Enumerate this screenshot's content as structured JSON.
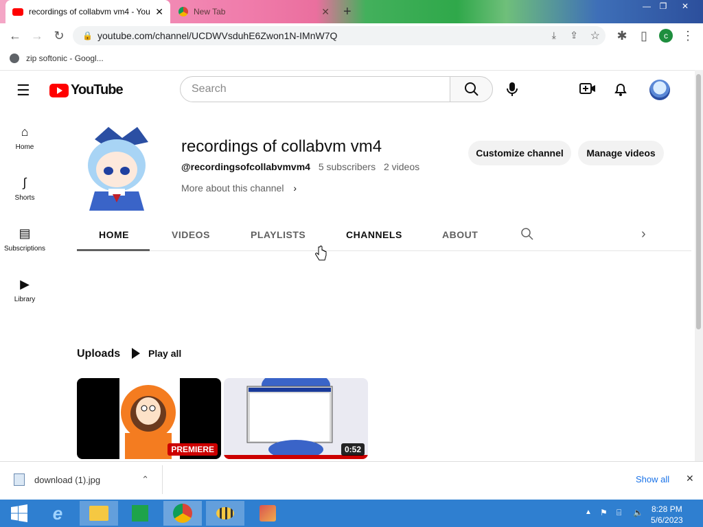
{
  "browser": {
    "tabs": [
      {
        "title": "recordings of collabvm vm4 - You",
        "active": true
      },
      {
        "title": "New Tab",
        "active": false
      }
    ],
    "new_tab": "+",
    "window_buttons": {
      "minimize": "—",
      "restore": "❐",
      "close": "✕"
    },
    "url": "youtube.com/channel/UCDWVsduhE6Zwon1N-IMnW7Q",
    "profile_initial": "c",
    "bookmarks": [
      {
        "label": "zip softonic - Googl..."
      }
    ]
  },
  "youtube": {
    "logo_text": "YouTube",
    "search_placeholder": "Search",
    "sidebar": [
      {
        "label": "Home",
        "icon": "home-icon"
      },
      {
        "label": "Shorts",
        "icon": "shorts-icon"
      },
      {
        "label": "Subscriptions",
        "icon": "subscriptions-icon"
      },
      {
        "label": "Library",
        "icon": "library-icon"
      }
    ]
  },
  "channel": {
    "title": "recordings of collabvm vm4",
    "handle": "@recordingsofcollabvmvm4",
    "subscribers": "5 subscribers",
    "videos": "2 videos",
    "more_about": "More about this channel",
    "customize_button": "Customize channel",
    "manage_button": "Manage videos",
    "tabs": [
      "HOME",
      "VIDEOS",
      "PLAYLISTS",
      "CHANNELS",
      "ABOUT"
    ],
    "active_tab": "HOME"
  },
  "uploads": {
    "title": "Uploads",
    "play_all": "Play all",
    "videos": [
      {
        "badge": "PREMIERE",
        "badge_color": "#cc0000"
      },
      {
        "badge": "0:52",
        "badge_color": "#000000"
      }
    ]
  },
  "download_bar": {
    "file": "download (1).jpg",
    "show_all": "Show all"
  },
  "taskbar": {
    "time": "8:28 PM",
    "date": "5/6/2023"
  }
}
